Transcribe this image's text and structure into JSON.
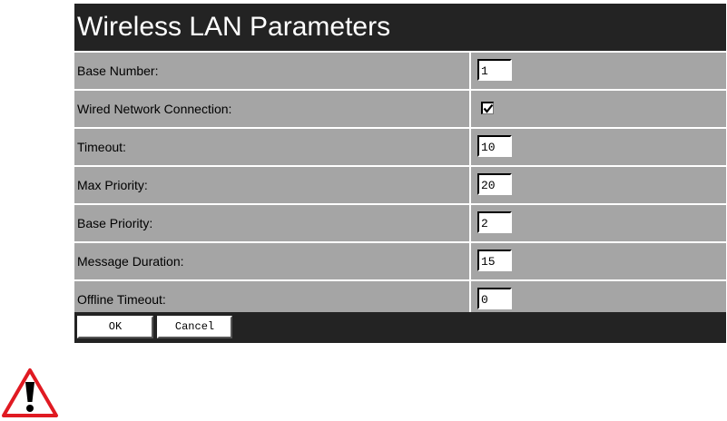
{
  "dialog": {
    "title": "Wireless LAN Parameters"
  },
  "fields": [
    {
      "label": "Base Number:",
      "type": "text",
      "value": "1"
    },
    {
      "label": "Wired Network Connection:",
      "type": "checkbox",
      "checked": true
    },
    {
      "label": "Timeout:",
      "type": "text",
      "value": "10"
    },
    {
      "label": "Max Priority:",
      "type": "text",
      "value": "20"
    },
    {
      "label": "Base Priority:",
      "type": "text",
      "value": "2"
    },
    {
      "label": "Message Duration:",
      "type": "text",
      "value": "15"
    },
    {
      "label": "Offline Timeout:",
      "type": "text",
      "value": "0"
    }
  ],
  "buttons": {
    "ok_label": "OK",
    "cancel_label": "Cancel"
  },
  "icons": {
    "warning": "warning-triangle-icon",
    "checkmark": "checkmark-icon"
  },
  "colors": {
    "header_bg": "#232323",
    "row_bg": "#a5a5a5",
    "warning_red": "#e01a22"
  }
}
